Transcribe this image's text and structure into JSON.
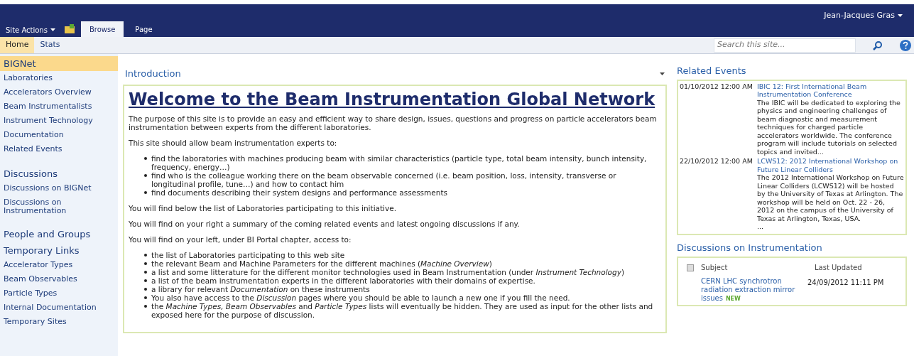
{
  "top_bar": {
    "site_actions": "Site Actions",
    "tabs": [
      {
        "label": "Browse",
        "selected": true
      },
      {
        "label": "Page",
        "selected": false
      }
    ],
    "user": "Jean-Jacques Gras"
  },
  "nav": {
    "links": [
      {
        "label": "Home",
        "selected": true
      },
      {
        "label": "Stats",
        "selected": false
      }
    ],
    "search": {
      "placeholder": "Search this site..."
    }
  },
  "sidebar": {
    "sections": [
      {
        "heading": "BIGNet",
        "selected": true,
        "items": [
          "Laboratories",
          "Accelerators Overview",
          "Beam Instrumentalists",
          "Instrument Technology",
          "Documentation",
          "Related Events"
        ]
      },
      {
        "heading": "Discussions",
        "selected": false,
        "items": [
          "Discussions on BIGNet",
          "Discussions on Instrumentation"
        ]
      },
      {
        "heading": "People and Groups",
        "selected": false
      },
      {
        "heading": "Temporary Links",
        "selected": false,
        "items": [
          "Accelerator Types",
          "Beam Observables",
          "Particle Types",
          "Internal Documentation",
          "Temporary Sites"
        ]
      }
    ]
  },
  "introduction": {
    "title": "Introduction",
    "heading": "Welcome to the Beam Instrumentation Global Network",
    "blocks": [
      {
        "kind": "paragraph",
        "text": "The purpose of this site is to provide an easy and efficient way to share design, issues, questions and progress on particle accelerators beam instrumentation between experts from the different laboratories."
      },
      {
        "kind": "paragraph",
        "text": "This site should allow beam instrumentation experts to:"
      },
      {
        "kind": "list",
        "items": [
          "find the laboratories with machines producing beam with similar characteristics (particle type, total beam intensity, bunch intensity, frequency, energy…)",
          "find who is the colleague working there on the beam observable concerned (i.e. beam position, loss, intensity, transverse or longitudinal profile, tune…) and how to contact him",
          "find documents describing their system designs and performance assessments"
        ]
      },
      {
        "kind": "paragraph",
        "text": "You will find below the list of Laboratories participating to this initiative."
      },
      {
        "kind": "paragraph",
        "text": "You will find on your right a summary of the coming related events and latest ongoing discussions if any."
      },
      {
        "kind": "paragraph",
        "text": "You will find on your left, under BI Portal chapter, access to:"
      },
      {
        "kind": "list",
        "items": [
          "the list of Laboratories participating to this web site",
          "the relevant Beam and Machine Parameters for the different machines (*Machine Overview*)",
          "a list and some litterature for the different monitor technologies used  in Beam Instrumentation (under *Instrument Technology*)",
          "a list of the beam instrumentation experts in the different laboratories with their domains of expertise.",
          "a library for relevant *Documentation* on these instruments",
          "You also have access to the *Discussion* pages where you should be able to launch a new one if you fill the need.",
          "the *Machine Types, Beam Observables* and *Particle Types* lists will eventually be hidden. They are used as input for the other lists and exposed here for the purpose of discussion."
        ]
      }
    ]
  },
  "related_events": {
    "title": "Related Events",
    "events": [
      {
        "date": "01/10/2012 12:00 AM",
        "title": "IBIC 12: First International Beam Instrumentation Conference",
        "description": "The IBIC will be dedicated to exploring the physics and engineering challenges of beam diagnostic and measurement techniques for charged particle accelerators worldwide. The conference program will include tutorials on selected topics and invited..."
      },
      {
        "date": "22/10/2012 12:00 AM",
        "title": "LCWS12: 2012 International Workshop on Future Linear Colliders",
        "description": "The 2012 International Workshop on Future Linear Colliders (LCWS12) will be hosted by the University of Texas at Arlington. The workshop will be held on Oct. 22 - 26, 2012 on the campus of the University of Texas at Arlington, Texas, USA.",
        "more": "..."
      }
    ]
  },
  "discussions": {
    "title": "Discussions on Instrumentation",
    "select_all_checked": false,
    "columns": [
      "Subject",
      "Last Updated"
    ],
    "rows": [
      {
        "subject": "CERN LHC synchrotron radiation extraction mirror issues",
        "badge": "NEW",
        "updated": "24/09/2012 11:11 PM"
      }
    ]
  }
}
